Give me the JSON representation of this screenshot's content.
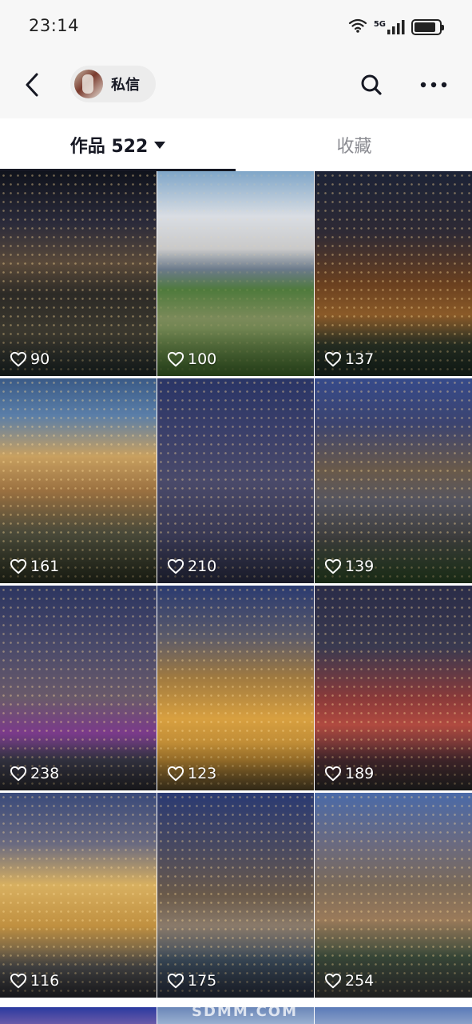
{
  "status_bar": {
    "time": "23:14",
    "network": "5G",
    "battery_level": 0.85,
    "icons": [
      "wifi-icon",
      "signal-icon",
      "battery-icon"
    ]
  },
  "header": {
    "back_icon": "chevron-left-icon",
    "dm_label": "私信",
    "search_icon": "search-icon",
    "more_icon": "more-icon"
  },
  "tabs": {
    "works_label": "作品 522",
    "favorites_label": "收藏"
  },
  "grid": {
    "items": [
      {
        "likes": "90",
        "bg": "linear-gradient(180deg,#10131c 0%,#2a2a3a 25%,#5a4a3a 45%,#2c2a26 60%,#3d3a30 80%,#1f2a2a 100%)"
      },
      {
        "likes": "100",
        "bg": "linear-gradient(180deg,#7fa6c8 0%,#d9dde3 22%,#c9c9c9 38%,#6b7a8a 48%,#4f7a3c 58%,#7b8a5a 72%,#3f6b2a 100%)"
      },
      {
        "likes": "137",
        "bg": "linear-gradient(180deg,#1c2336 0%,#2e2a35 30%,#6a4020 55%,#8a5a28 70%,#2a3326 85%,#1a2a22 100%)"
      },
      {
        "likes": "161",
        "bg": "linear-gradient(180deg,#3a5a86 0%,#5a7ea8 18%,#c8a060 38%,#9a7040 55%,#4a4a3a 75%,#2a3020 100%)"
      },
      {
        "likes": "210",
        "bg": "linear-gradient(180deg,#2a3566 0%,#3a3f6a 25%,#4a4a6a 50%,#3a3a55 75%,#2c2f48 100%)"
      },
      {
        "likes": "139",
        "bg": "linear-gradient(180deg,#364a8a 0%,#3c4470 22%,#6a5a4a 45%,#555560 60%,#3c3c3c 78%,#2c4a26 100%)"
      },
      {
        "likes": "238",
        "bg": "linear-gradient(180deg,#2c3560 0%,#4a4a6a 30%,#6a5a6a 55%,#7a3a8a 72%,#3a3a4a 85%,#2a2a30 100%)"
      },
      {
        "likes": "123",
        "bg": "linear-gradient(180deg,#2a3a70 0%,#5a5a6a 25%,#a07a40 45%,#d8a040 65%,#b08030 85%,#5a4a2a 100%)"
      },
      {
        "likes": "189",
        "bg": "linear-gradient(180deg,#2a2c48 0%,#3a3a50 30%,#8a3a3a 55%,#b04a40 68%,#4a2a30 85%,#2a2a2a 100%)"
      },
      {
        "likes": "116",
        "bg": "linear-gradient(180deg,#3a4a7a 0%,#6a6a80 25%,#d8b060 45%,#c09040 65%,#4a4a4a 85%,#2a2a30 100%)"
      },
      {
        "likes": "175",
        "bg": "linear-gradient(180deg,#2a3a72 0%,#4a4a60 28%,#6a5a4a 50%,#8a7a6a 65%,#3a4a5a 82%,#2a3040 100%)"
      },
      {
        "likes": "254",
        "bg": "linear-gradient(180deg,#4a6aa8 0%,#6a6a80 25%,#7a6a5a 45%,#9a7a5a 62%,#3a4a3a 80%,#3a3a3a 100%)"
      }
    ],
    "partial_row_bgs": [
      "linear-gradient(180deg,#2a3aa0,#6a5aa8)",
      "linear-gradient(180deg,#6a86b8,#9ab0d0)",
      "linear-gradient(180deg,#5a7ab8,#8aa0c8)"
    ]
  },
  "watermark": "SDMM.COM",
  "colors": {
    "text_primary": "#161823",
    "text_secondary": "#8a8b91",
    "header_bg": "#f7f7f7",
    "pill_bg": "#ececec"
  }
}
